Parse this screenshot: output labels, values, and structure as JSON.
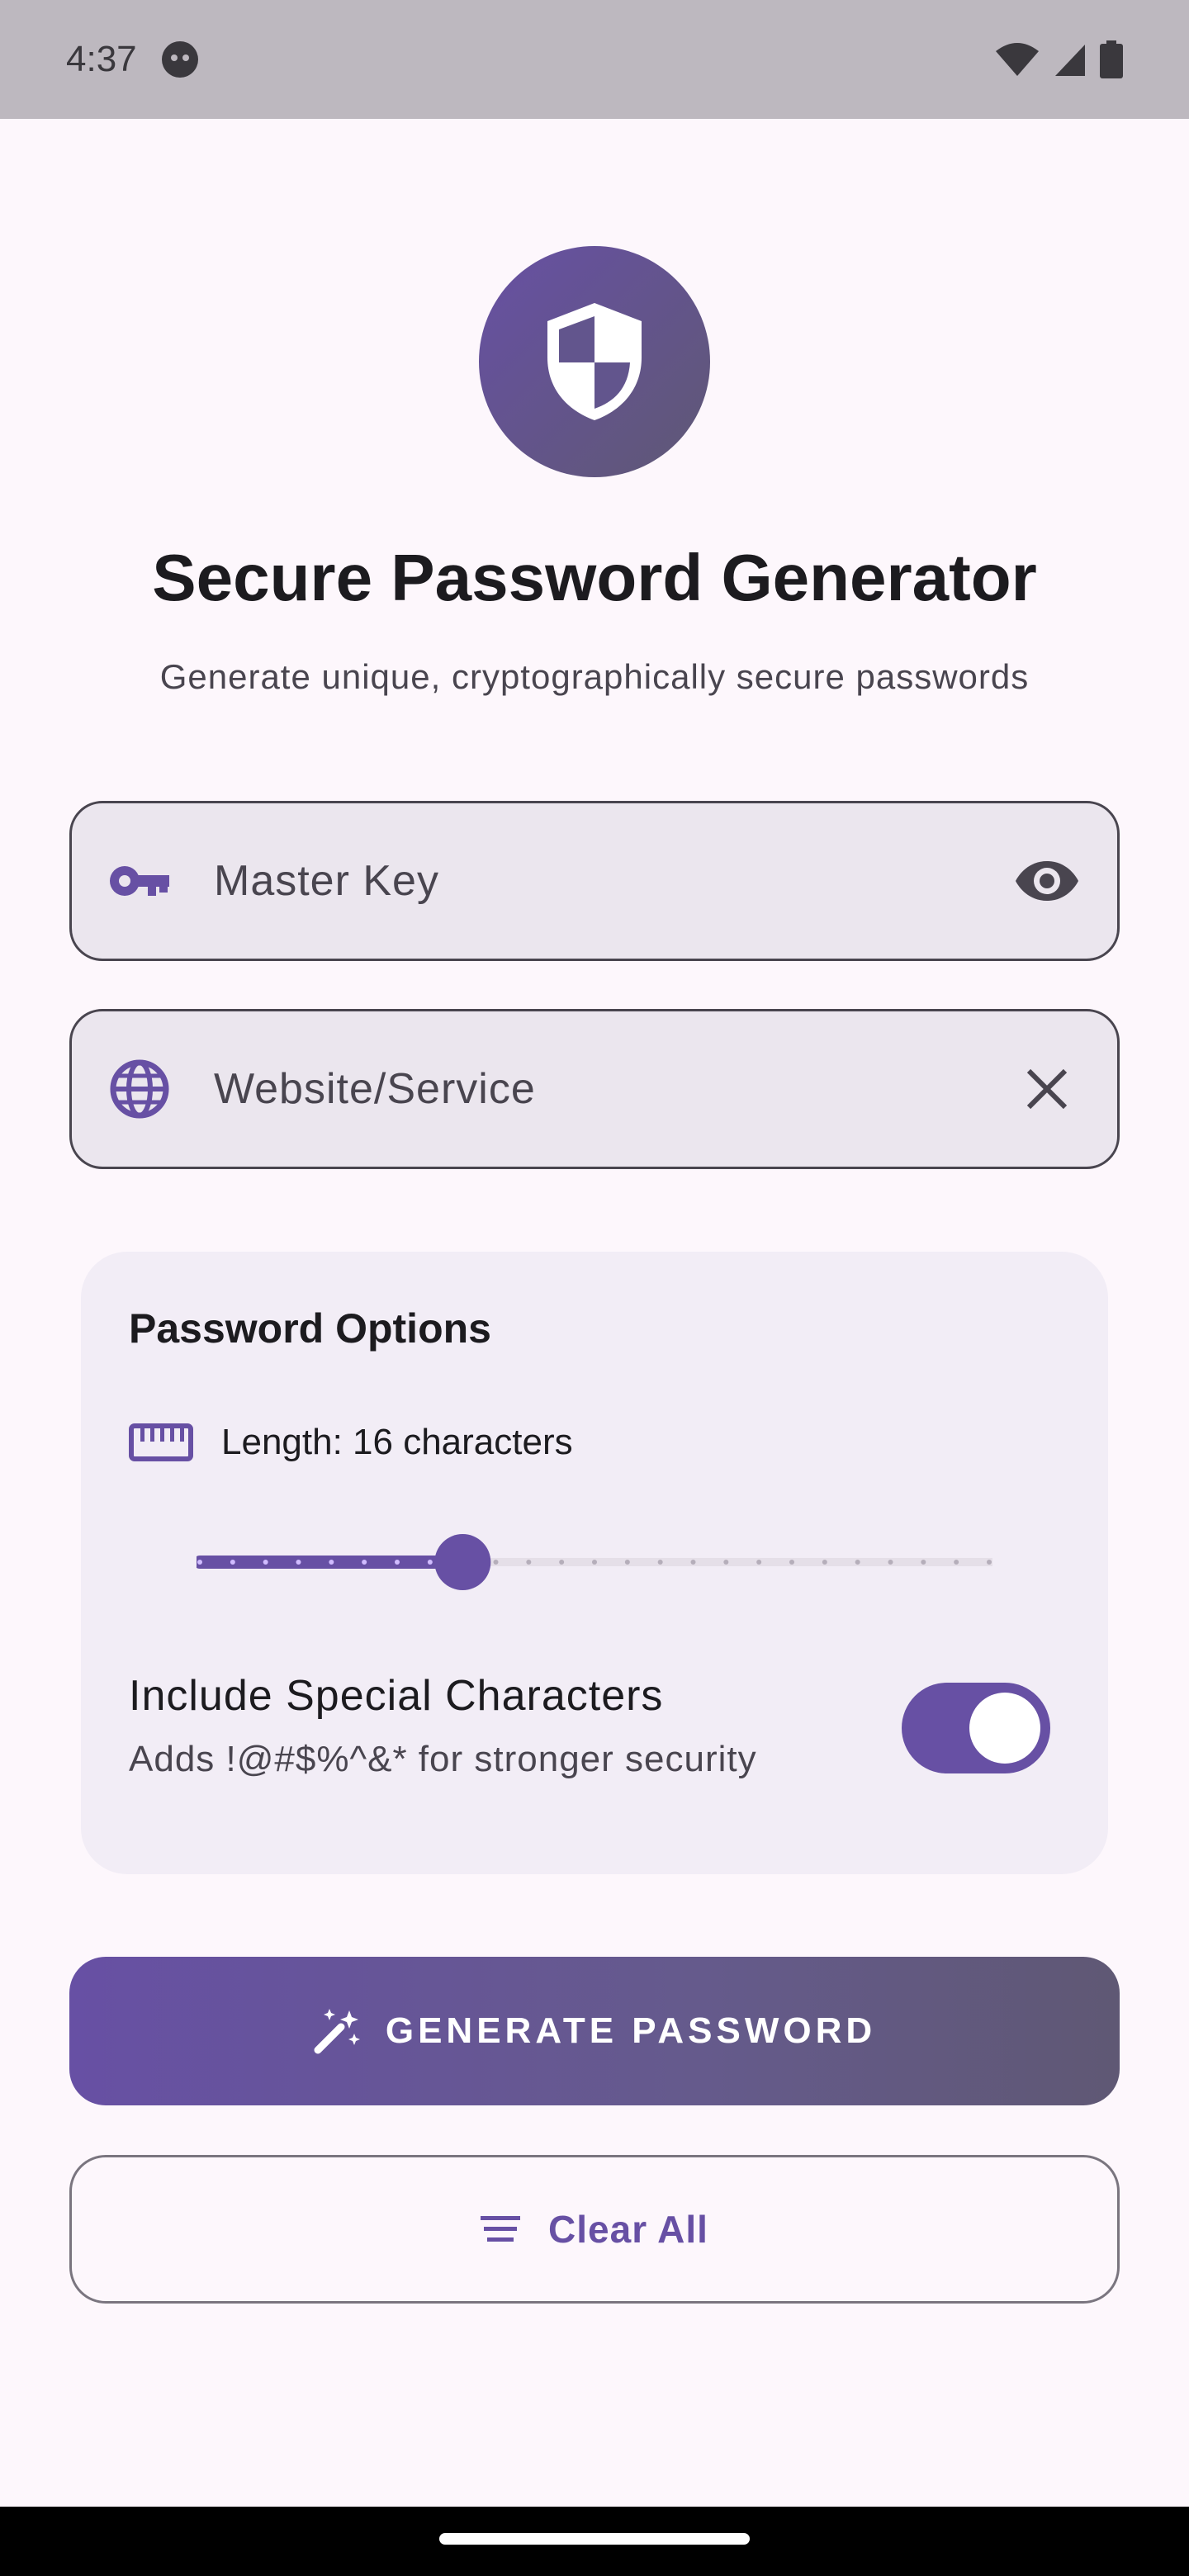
{
  "status_bar": {
    "time": "4:37"
  },
  "header": {
    "title": "Secure Password Generator",
    "subtitle": "Generate unique, cryptographically secure passwords"
  },
  "fields": {
    "master_key_placeholder": "Master Key",
    "website_placeholder": "Website/Service"
  },
  "options": {
    "title": "Password Options",
    "length_label": "Length: 16 characters",
    "length_value": 16,
    "length_min": 4,
    "length_max": 64,
    "slider_progress_fraction": 0.333,
    "special_title": "Include Special Characters",
    "special_desc": "Adds !@#$%^&* for stronger security",
    "special_enabled": true
  },
  "actions": {
    "generate_label": "GENERATE PASSWORD",
    "clear_label": "Clear All"
  },
  "colors": {
    "primary": "#6750a4",
    "background": "#fdf7fc",
    "surface_variant": "#ebe6ee",
    "card": "#f2edf6"
  },
  "icons": {
    "logo": "shield-icon",
    "master_key_lead": "key-icon",
    "master_key_trail": "eye-icon",
    "website_lead": "globe-icon",
    "website_trail": "close-icon",
    "length": "ruler-icon",
    "generate": "magic-wand-icon",
    "clear": "clear-all-icon"
  }
}
